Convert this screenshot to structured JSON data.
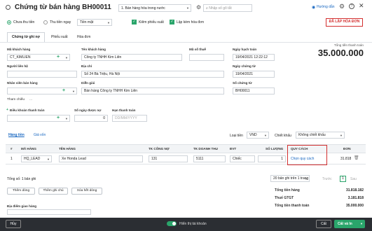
{
  "header": {
    "title": "Chứng từ bán hàng BH00011",
    "type_select": "1. Bán hàng hóa trong nước",
    "search_placeholder": "Nhập số gõ tắt",
    "help_label": "Hướng dẫn"
  },
  "options": {
    "payment_unpaid": "Chưa thu tiền",
    "payment_paid": "Thu tiền ngay",
    "payment_method": "Tiền mặt",
    "export_with_invoice": "Kiêm phiếu xuất",
    "create_invoice": "Lập kèm hóa đơn"
  },
  "status_badge": "ĐÃ LẬP HÓA ĐƠN",
  "tabs": [
    "Chứng từ ghi nợ",
    "Phiếu xuất",
    "Hóa đơn"
  ],
  "total": {
    "label": "Tổng tiền thanh toán",
    "value": "35.000.000"
  },
  "form": {
    "customer_code_label": "Mã khách hàng",
    "customer_code": "CT_KIMLIEN",
    "customer_name_label": "Tên khách hàng",
    "customer_name": "Công ty TNHH Kim Liên",
    "tax_code_label": "Mã số thuế",
    "tax_code": "",
    "posting_date_label": "Ngày hạch toán",
    "posting_date": "19/04/2021 12:22:12",
    "contact_label": "Người liên hệ",
    "contact": "",
    "address_label": "Địa chỉ",
    "address": "Số 24 Bà Triệu, Hà Nội",
    "voucher_date_label": "Ngày chứng từ",
    "voucher_date": "19/04/2021",
    "employee_label": "Nhân viên bán hàng",
    "employee": "",
    "description_label": "Diễn giải",
    "description": "Bán hàng Công ty TNHH Kim Liên",
    "voucher_no_label": "Số chứng từ",
    "voucher_no": "BH00011",
    "reference_label": "Tham chiếu",
    "reference_dots": "...",
    "payment_terms_label": "Điều khoản thanh toán",
    "payment_terms": "",
    "days_owed_label": "Số ngày được nợ",
    "days_owed": "0",
    "due_date_label": "Hạn thanh toán",
    "due_date_placeholder": "DD/MM/YYYY"
  },
  "subtabs": [
    "Hàng tiền",
    "Giá vốn"
  ],
  "currency": {
    "label": "Loại tiền",
    "value": "VND",
    "discount_label": "Chiết khấu",
    "discount_value": "Không chiết khấu"
  },
  "table": {
    "headers": [
      "#",
      "MÃ HÀNG",
      "TÊN HÀNG",
      "TK CÔNG NỢ",
      "TK DOANH THU",
      "ĐVT",
      "SỐ LƯỢNG",
      "QUY CÁCH",
      "ĐƠN"
    ],
    "row": {
      "index": "1",
      "code": "HQ_LEAD",
      "name": "Xe Honda Lead",
      "debt_account": "131",
      "revenue_account": "5111",
      "unit": "Chiếc",
      "quantity": "1",
      "spec": "Chọn quy cách",
      "price": "31.818"
    },
    "footer_count": "Tổng số: 1 bản ghi",
    "page_size": "20 bản ghi trên 1 trang",
    "prev": "Trước",
    "page": "1",
    "next": "Sau"
  },
  "row_buttons": [
    "Thêm dòng",
    "Thêm ghi chú",
    "Xóa hết dòng"
  ],
  "delivery_label": "Địa điểm giao hàng",
  "summary": [
    {
      "label": "Tổng tiền hàng",
      "value": "31.818.182"
    },
    {
      "label": "Thuế GTGT",
      "value": "3.181.818"
    },
    {
      "label": "Tổng tiền thanh toán",
      "value": "35.000.000"
    }
  ],
  "footer": {
    "cancel": "Hủy",
    "show_accounts": "Hiển thị tài khoản",
    "save": "Cất",
    "save_print": "Cất và In"
  },
  "colors": {
    "accent": "#2aa56b",
    "badge_red": "#d32f2f",
    "footer_bg": "#2b2e33",
    "link_blue": "#1565c0"
  }
}
